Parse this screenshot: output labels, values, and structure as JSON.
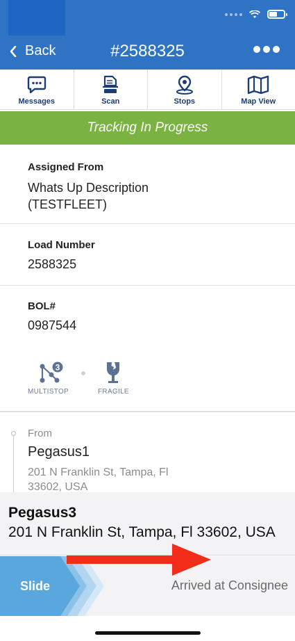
{
  "nav": {
    "back_label": "Back",
    "title": "#2588325"
  },
  "toolbar": {
    "items": [
      {
        "label": "Messages",
        "icon": "chat-bubble-icon"
      },
      {
        "label": "Scan",
        "icon": "scanner-icon"
      },
      {
        "label": "Stops",
        "icon": "map-pin-icon"
      },
      {
        "label": "Map View",
        "icon": "folded-map-icon"
      }
    ]
  },
  "banner": {
    "text": "Tracking In Progress",
    "color": "#7ab342"
  },
  "details": {
    "assigned_from": {
      "label": "Assigned From",
      "value_line1": "Whats Up Description",
      "value_line2": "(TESTFLEET)"
    },
    "load_number": {
      "label": "Load Number",
      "value": "2588325"
    },
    "bol": {
      "label": "BOL#",
      "value": "0987544"
    }
  },
  "badges": {
    "multistop": {
      "label": "MULTISTOP",
      "count": "3",
      "icon": "multistop-icon"
    },
    "fragile": {
      "label": "FRAGILE",
      "icon": "fragile-glass-icon"
    }
  },
  "route": {
    "from_label": "From",
    "origin_name": "Pegasus1",
    "origin_address": "201 N Franklin St, Tampa, Fl 33602, USA"
  },
  "destination": {
    "name": "Pegasus3",
    "address": "201 N Franklin St, Tampa, Fl 33602, USA"
  },
  "slider": {
    "button_label": "Slide",
    "action_text": "Arrived at Consignee"
  },
  "colors": {
    "header": "#2f74c4",
    "icon_navy": "#1c3d73",
    "slide_blue": "#5aa7dd",
    "arrow_red": "#f22d1a"
  }
}
